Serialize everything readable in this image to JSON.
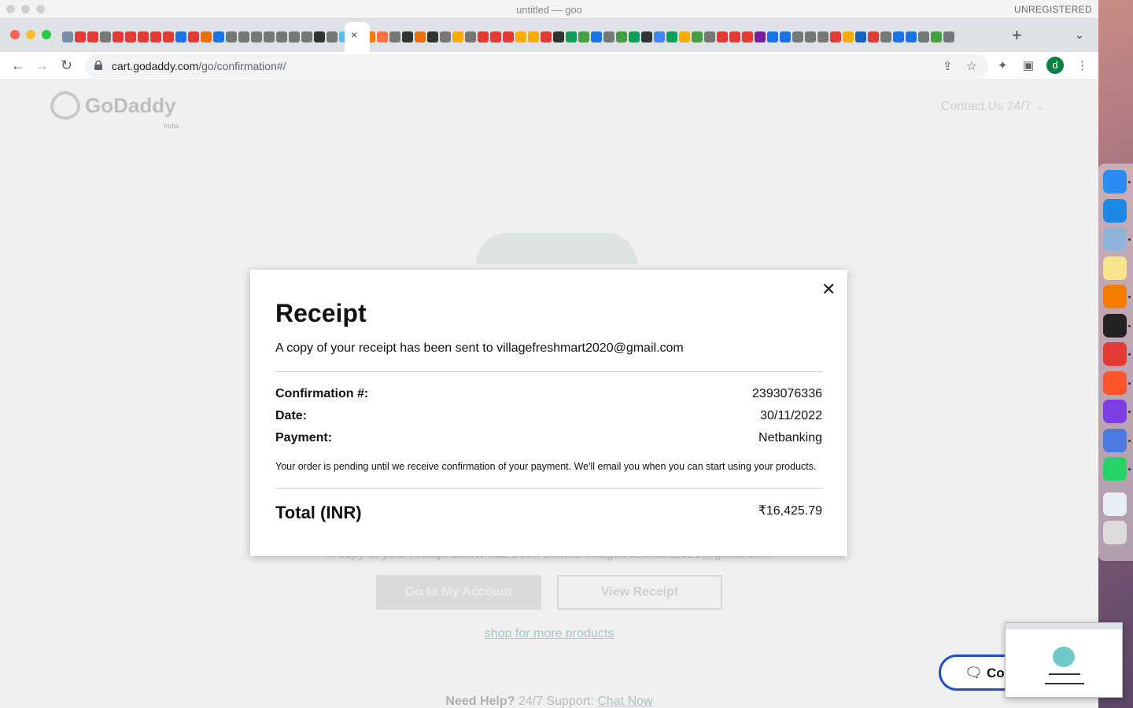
{
  "menubar": {
    "window_title": "untitled — goo",
    "license": "UNREGISTERED"
  },
  "browser": {
    "active_tab_close": "×",
    "new_tab": "+",
    "tab_list": "⌄",
    "url_host": "cart.godaddy.com",
    "url_path": "/go/confirmation#/",
    "profile_initial": "d",
    "favicon_colors": [
      "#7a8ba6",
      "#e53935",
      "#e53935",
      "#777",
      "#e53935",
      "#e53935",
      "#e53935",
      "#e53935",
      "#e53935",
      "#1a73e8",
      "#e53935",
      "#e8710a",
      "#1a73e8",
      "#777",
      "#777",
      "#777",
      "#777",
      "#777",
      "#777",
      "#777",
      "#333",
      "#777",
      "#4fc3f7",
      "#ff7043",
      "#f57c00",
      "#ff7043",
      "#777",
      "#333",
      "#e8710a",
      "#333",
      "#777",
      "#f9ab00",
      "#777",
      "#e53935",
      "#e53935",
      "#e53935",
      "#f9ab00",
      "#f9ab00",
      "#e53935",
      "#333",
      "#0f9d58",
      "#43a047",
      "#1a73e8",
      "#777",
      "#43a047",
      "#0f9d58",
      "#333",
      "#4285f4",
      "#0f9d58",
      "#f9ab00",
      "#43a047",
      "#777",
      "#e53935",
      "#e53935",
      "#e53935",
      "#7b1fa2",
      "#1a73e8",
      "#1a73e8",
      "#777",
      "#777",
      "#777",
      "#e53935",
      "#f9ab00",
      "#1565c0",
      "#e53935",
      "#777",
      "#1a73e8",
      "#1a73e8",
      "#777",
      "#43a047",
      "#777"
    ]
  },
  "page": {
    "logo_text": "GoDaddy",
    "logo_sub": "India",
    "contact": "Contact Us 24/7 ⌄",
    "background_message": "A copy of your receipt below has been sent to villagefreshmart2020@gmail.com",
    "go_to_account": "Go to My Account",
    "view_receipt": "View Receipt",
    "shop_more": "shop for more products",
    "need_help": "Need Help?",
    "support_text": " 24/7 Support: ",
    "chat_now": "Chat Now"
  },
  "receipt": {
    "close": "✕",
    "title": "Receipt",
    "subtitle": "A copy of your receipt has been sent to villagefreshmart2020@gmail.com",
    "rows": [
      {
        "label": "Confirmation #:",
        "value": "2393076336"
      },
      {
        "label": "Date:",
        "value": "30/11/2022"
      },
      {
        "label": "Payment:",
        "value": "Netbanking"
      }
    ],
    "note": "Your order is pending until we receive confirmation of your payment. We'll email you when you can start using your products.",
    "total_label": "Total (INR)",
    "total_value": "₹16,425.79"
  },
  "chat_widget": {
    "label": "Co"
  },
  "dock": {
    "apps": [
      {
        "name": "finder-icon",
        "color": "#2a8cf0",
        "running": true
      },
      {
        "name": "safari-icon",
        "color": "#1e88e5",
        "running": false
      },
      {
        "name": "preview-icon",
        "color": "#8fb3d9",
        "running": true
      },
      {
        "name": "notes-icon",
        "color": "#f6e58d",
        "running": false
      },
      {
        "name": "sublime-text-icon",
        "color": "#f57c00",
        "running": true
      },
      {
        "name": "terminal-icon",
        "color": "#222222",
        "running": true
      },
      {
        "name": "chrome-icon",
        "color": "#e53935",
        "running": true
      },
      {
        "name": "brave-icon",
        "color": "#fb542b",
        "running": true
      },
      {
        "name": "firefox-icon",
        "color": "#7b3fe4",
        "running": true
      },
      {
        "name": "chromium-icon",
        "color": "#4a7be0",
        "running": true
      },
      {
        "name": "whatsapp-icon",
        "color": "#25d366",
        "running": true
      },
      {
        "name": "downloads-icon",
        "color": "#e8eef5",
        "running": false
      },
      {
        "name": "trash-icon",
        "color": "#dcdcdc",
        "running": false
      }
    ]
  }
}
